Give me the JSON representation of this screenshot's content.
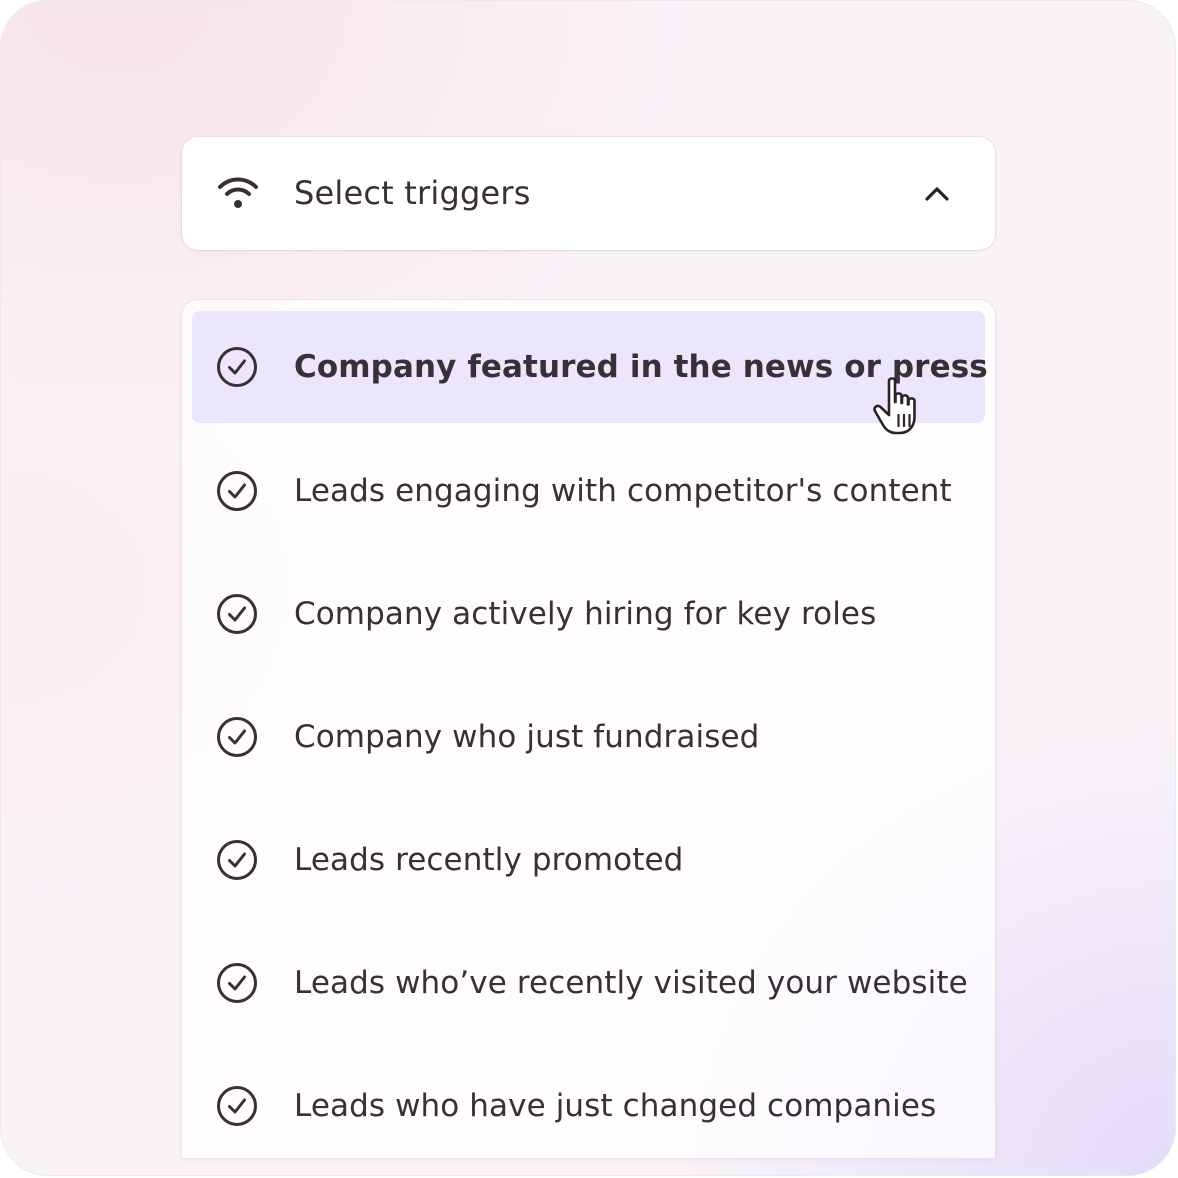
{
  "trigger_select": {
    "icon": "wifi-signal-icon",
    "label": "Select triggers",
    "expanded": true,
    "chevron_icon": "chevron-up-icon"
  },
  "options": [
    {
      "label": "Company featured in the news or press",
      "icon": "check-circle-icon",
      "active": true
    },
    {
      "label": "Leads engaging with competitor's content",
      "icon": "check-circle-icon",
      "active": false
    },
    {
      "label": "Company actively hiring for key roles",
      "icon": "check-circle-icon",
      "active": false
    },
    {
      "label": "Company who just fundraised",
      "icon": "check-circle-icon",
      "active": false
    },
    {
      "label": "Leads recently promoted",
      "icon": "check-circle-icon",
      "active": false
    },
    {
      "label": "Leads who’ve recently visited your website",
      "icon": "check-circle-icon",
      "active": false
    },
    {
      "label": "Leads who have just changed companies",
      "icon": "check-circle-icon",
      "active": false
    }
  ],
  "cursor_icon": "hand-pointer-icon",
  "colors": {
    "text": "#3a2f37",
    "active_row": "#ebe6fb",
    "panel": "#ffffff"
  }
}
